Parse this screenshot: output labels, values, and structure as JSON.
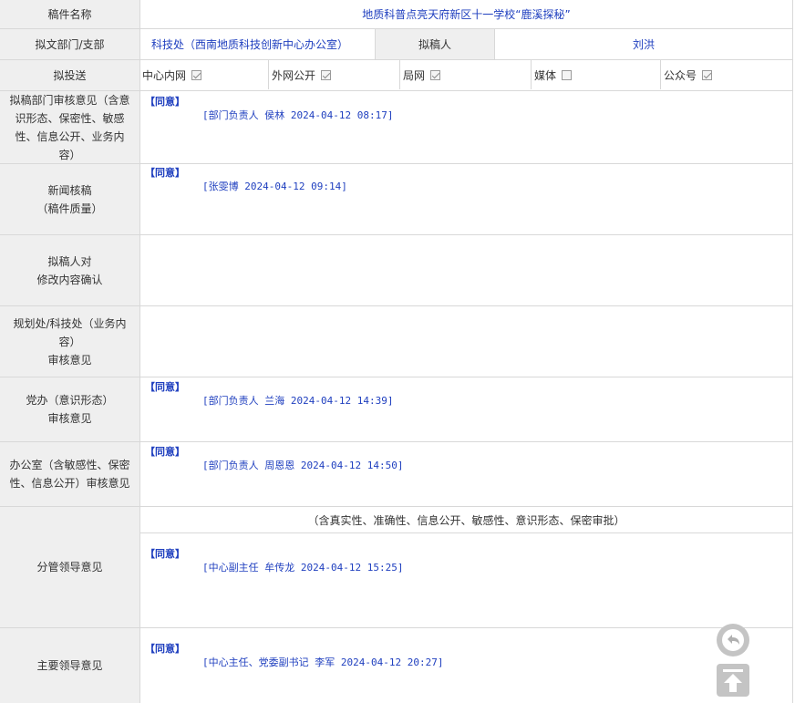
{
  "rows": {
    "title": {
      "label": "稿件名称",
      "value": "地质科普点亮天府新区十一学校“鹿溪探秘”"
    },
    "department": {
      "label": "拟文部门/支部",
      "value": "科技处（西南地质科技创新中心办公室）",
      "drafter_label": "拟稿人",
      "drafter_value": "刘洪"
    },
    "send": {
      "label": "拟投送",
      "options": [
        {
          "label": "中心内网",
          "checked": true
        },
        {
          "label": "外网公开",
          "checked": true
        },
        {
          "label": "局网",
          "checked": true
        },
        {
          "label": "媒体",
          "checked": false
        },
        {
          "label": "公众号",
          "checked": true
        }
      ]
    },
    "dept_review": {
      "label_lines": [
        "拟稿部门审核意见（含意",
        "识形态、保密性、敏感",
        "性、信息公开、业务内",
        "容）"
      ],
      "agree": "【同意】",
      "sign": "[部门负责人 侯林 2024-04-12 08:17]"
    },
    "news_review": {
      "label_lines": [
        "新闻核稿",
        "（稿件质量）"
      ],
      "agree": "【同意】",
      "sign": "[张雯博 2024-04-12 09:14]"
    },
    "drafter_confirm": {
      "label_lines": [
        "拟稿人对",
        "修改内容确认"
      ]
    },
    "planning_review": {
      "label_lines": [
        "规划处/科技处（业务内",
        "容）",
        "审核意见"
      ]
    },
    "party_review": {
      "label_lines": [
        "党办（意识形态）",
        "审核意见"
      ],
      "agree": "【同意】",
      "sign": "[部门负责人 兰海 2024-04-12 14:39]"
    },
    "office_review": {
      "label_lines": [
        "办公室（含敏感性、保密",
        "性、信息公开）审核意见"
      ],
      "agree": "【同意】",
      "sign": "[部门负责人 周恩恩 2024-04-12 14:50]"
    },
    "leader_review": {
      "label": "分管领导意见",
      "note": "（含真实性、准确性、信息公开、敏感性、意识形态、保密审批）",
      "agree": "【同意】",
      "sign": "[中心副主任 牟传龙 2024-04-12 15:25]"
    },
    "main_leader_review": {
      "label": "主要领导意见",
      "agree": "【同意】",
      "sign": "[中心主任、党委副书记 李军 2024-04-12 20:27]"
    }
  },
  "floating": {
    "back_icon": "reply-arrow-icon",
    "top_icon": "back-to-top-icon"
  }
}
